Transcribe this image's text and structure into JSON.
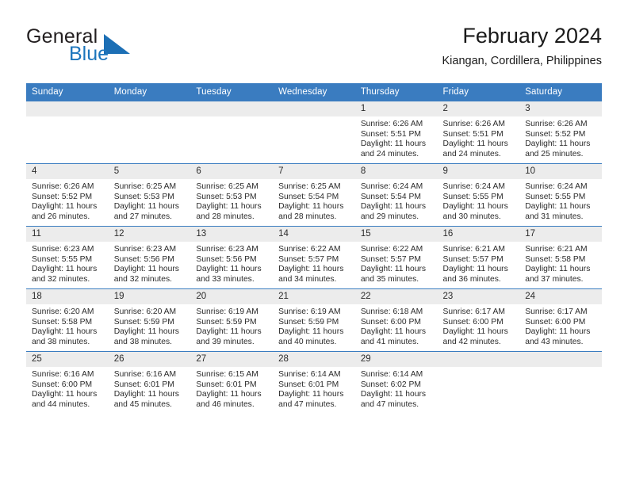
{
  "brand": {
    "name_top": "General",
    "name_bottom": "Blue",
    "accent_color": "#1c75bc",
    "logo_icon": "triangle-icon"
  },
  "header": {
    "title": "February 2024",
    "subtitle": "Kiangan, Cordillera, Philippines"
  },
  "calendar": {
    "header_bg": "#3a7cc0",
    "daynum_bg": "#ececec",
    "weekdays": [
      "Sunday",
      "Monday",
      "Tuesday",
      "Wednesday",
      "Thursday",
      "Friday",
      "Saturday"
    ],
    "weeks": [
      [
        {
          "day": "",
          "lines": []
        },
        {
          "day": "",
          "lines": []
        },
        {
          "day": "",
          "lines": []
        },
        {
          "day": "",
          "lines": []
        },
        {
          "day": "1",
          "lines": [
            "Sunrise: 6:26 AM",
            "Sunset: 5:51 PM",
            "Daylight: 11 hours and 24 minutes."
          ]
        },
        {
          "day": "2",
          "lines": [
            "Sunrise: 6:26 AM",
            "Sunset: 5:51 PM",
            "Daylight: 11 hours and 24 minutes."
          ]
        },
        {
          "day": "3",
          "lines": [
            "Sunrise: 6:26 AM",
            "Sunset: 5:52 PM",
            "Daylight: 11 hours and 25 minutes."
          ]
        }
      ],
      [
        {
          "day": "4",
          "lines": [
            "Sunrise: 6:26 AM",
            "Sunset: 5:52 PM",
            "Daylight: 11 hours and 26 minutes."
          ]
        },
        {
          "day": "5",
          "lines": [
            "Sunrise: 6:25 AM",
            "Sunset: 5:53 PM",
            "Daylight: 11 hours and 27 minutes."
          ]
        },
        {
          "day": "6",
          "lines": [
            "Sunrise: 6:25 AM",
            "Sunset: 5:53 PM",
            "Daylight: 11 hours and 28 minutes."
          ]
        },
        {
          "day": "7",
          "lines": [
            "Sunrise: 6:25 AM",
            "Sunset: 5:54 PM",
            "Daylight: 11 hours and 28 minutes."
          ]
        },
        {
          "day": "8",
          "lines": [
            "Sunrise: 6:24 AM",
            "Sunset: 5:54 PM",
            "Daylight: 11 hours and 29 minutes."
          ]
        },
        {
          "day": "9",
          "lines": [
            "Sunrise: 6:24 AM",
            "Sunset: 5:55 PM",
            "Daylight: 11 hours and 30 minutes."
          ]
        },
        {
          "day": "10",
          "lines": [
            "Sunrise: 6:24 AM",
            "Sunset: 5:55 PM",
            "Daylight: 11 hours and 31 minutes."
          ]
        }
      ],
      [
        {
          "day": "11",
          "lines": [
            "Sunrise: 6:23 AM",
            "Sunset: 5:55 PM",
            "Daylight: 11 hours and 32 minutes."
          ]
        },
        {
          "day": "12",
          "lines": [
            "Sunrise: 6:23 AM",
            "Sunset: 5:56 PM",
            "Daylight: 11 hours and 32 minutes."
          ]
        },
        {
          "day": "13",
          "lines": [
            "Sunrise: 6:23 AM",
            "Sunset: 5:56 PM",
            "Daylight: 11 hours and 33 minutes."
          ]
        },
        {
          "day": "14",
          "lines": [
            "Sunrise: 6:22 AM",
            "Sunset: 5:57 PM",
            "Daylight: 11 hours and 34 minutes."
          ]
        },
        {
          "day": "15",
          "lines": [
            "Sunrise: 6:22 AM",
            "Sunset: 5:57 PM",
            "Daylight: 11 hours and 35 minutes."
          ]
        },
        {
          "day": "16",
          "lines": [
            "Sunrise: 6:21 AM",
            "Sunset: 5:57 PM",
            "Daylight: 11 hours and 36 minutes."
          ]
        },
        {
          "day": "17",
          "lines": [
            "Sunrise: 6:21 AM",
            "Sunset: 5:58 PM",
            "Daylight: 11 hours and 37 minutes."
          ]
        }
      ],
      [
        {
          "day": "18",
          "lines": [
            "Sunrise: 6:20 AM",
            "Sunset: 5:58 PM",
            "Daylight: 11 hours and 38 minutes."
          ]
        },
        {
          "day": "19",
          "lines": [
            "Sunrise: 6:20 AM",
            "Sunset: 5:59 PM",
            "Daylight: 11 hours and 38 minutes."
          ]
        },
        {
          "day": "20",
          "lines": [
            "Sunrise: 6:19 AM",
            "Sunset: 5:59 PM",
            "Daylight: 11 hours and 39 minutes."
          ]
        },
        {
          "day": "21",
          "lines": [
            "Sunrise: 6:19 AM",
            "Sunset: 5:59 PM",
            "Daylight: 11 hours and 40 minutes."
          ]
        },
        {
          "day": "22",
          "lines": [
            "Sunrise: 6:18 AM",
            "Sunset: 6:00 PM",
            "Daylight: 11 hours and 41 minutes."
          ]
        },
        {
          "day": "23",
          "lines": [
            "Sunrise: 6:17 AM",
            "Sunset: 6:00 PM",
            "Daylight: 11 hours and 42 minutes."
          ]
        },
        {
          "day": "24",
          "lines": [
            "Sunrise: 6:17 AM",
            "Sunset: 6:00 PM",
            "Daylight: 11 hours and 43 minutes."
          ]
        }
      ],
      [
        {
          "day": "25",
          "lines": [
            "Sunrise: 6:16 AM",
            "Sunset: 6:00 PM",
            "Daylight: 11 hours and 44 minutes."
          ]
        },
        {
          "day": "26",
          "lines": [
            "Sunrise: 6:16 AM",
            "Sunset: 6:01 PM",
            "Daylight: 11 hours and 45 minutes."
          ]
        },
        {
          "day": "27",
          "lines": [
            "Sunrise: 6:15 AM",
            "Sunset: 6:01 PM",
            "Daylight: 11 hours and 46 minutes."
          ]
        },
        {
          "day": "28",
          "lines": [
            "Sunrise: 6:14 AM",
            "Sunset: 6:01 PM",
            "Daylight: 11 hours and 47 minutes."
          ]
        },
        {
          "day": "29",
          "lines": [
            "Sunrise: 6:14 AM",
            "Sunset: 6:02 PM",
            "Daylight: 11 hours and 47 minutes."
          ]
        },
        {
          "day": "",
          "lines": []
        },
        {
          "day": "",
          "lines": []
        }
      ]
    ]
  }
}
